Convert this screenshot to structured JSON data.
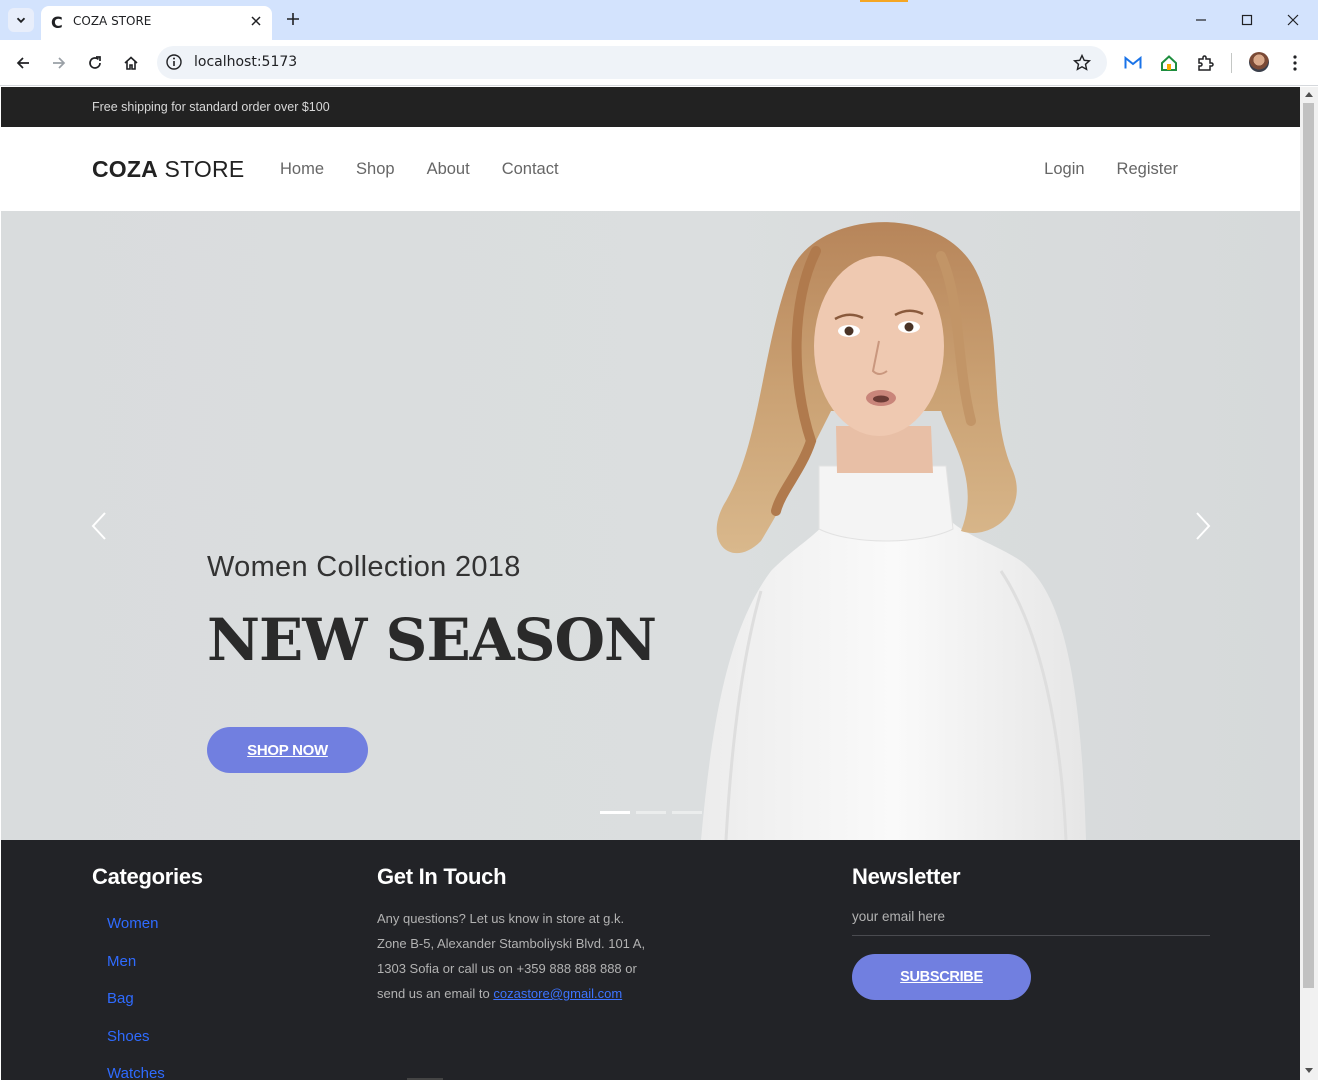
{
  "browser": {
    "tab_title": "COZA STORE",
    "url": "localhost:5173",
    "favicon_letter": "C"
  },
  "topbar": {
    "text": "Free shipping for standard order over $100"
  },
  "header": {
    "logo_bold": "COZA",
    "logo_light": " STORE",
    "menu": [
      "Home",
      "Shop",
      "About",
      "Contact"
    ],
    "auth": [
      "Login",
      "Register"
    ]
  },
  "hero": {
    "subtitle": "Women Collection 2018",
    "title": "NEW SEASON",
    "button": "SHOP NOW",
    "slides": 3,
    "active_slide": 1
  },
  "footer": {
    "categories": {
      "heading": "Categories",
      "items": [
        "Women",
        "Men",
        "Bag",
        "Shoes",
        "Watches"
      ]
    },
    "contact": {
      "heading": "Get In Touch",
      "text": "Any questions? Let us know in store at g.k. Zone B-5, Alexander Stamboliyski Blvd. 101 A, 1303 Sofia or call us on +359 888 888 888 or send us an email to",
      "email": "cozastore@gmail.com"
    },
    "newsletter": {
      "heading": "Newsletter",
      "placeholder": "your email here",
      "button": "SUBSCRIBE"
    }
  },
  "colors": {
    "accent": "#717fe0",
    "topbar_bg": "#222222",
    "footer_bg": "#222327",
    "link": "#2f6bff"
  }
}
